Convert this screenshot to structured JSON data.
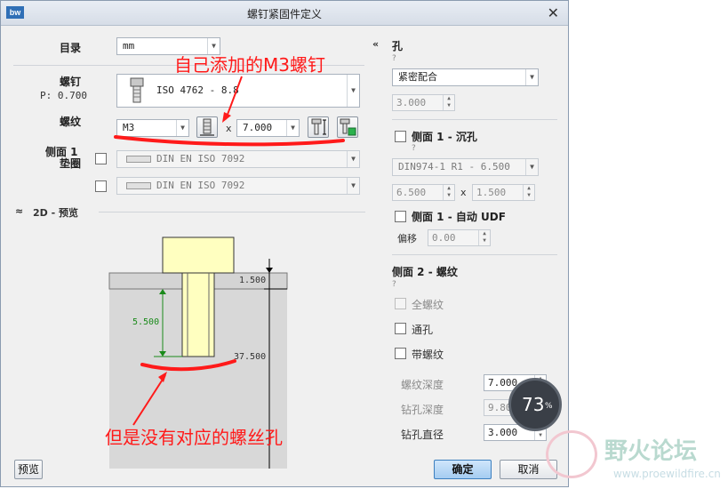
{
  "window": {
    "title": "螺钉紧固件定义",
    "logo": "bw"
  },
  "left": {
    "catalog_label": "目录",
    "catalog_value": "mm",
    "screw_label": "螺钉",
    "pitch_label": "P: 0.700",
    "screw_value": "ISO 4762 - 8.8",
    "thread_label": "螺纹",
    "thread_value": "M3",
    "times": "x",
    "length_value": "7.000",
    "side1_label_a": "侧面 1",
    "side1_label_b": "垫圈",
    "washer1_value": "DIN EN ISO 7092",
    "washer2_value": "DIN EN ISO 7092",
    "preview_section": "2D - 预览"
  },
  "preview": {
    "dim_top": "1.500",
    "dim_mid": "5.500",
    "dim_bottom": "37.500"
  },
  "right": {
    "hole_label": "孔",
    "hole_q": "?",
    "fit_value": "紧密配合",
    "fit_num": "3.000",
    "side1_counter_label": "侧面 1 - 沉孔",
    "side1_q": "?",
    "counter_value": "DIN974-1 R1 - 6.500",
    "counter_a": "6.500",
    "counter_x": "x",
    "counter_b": "1.500",
    "auto_udf_label": "侧面 1 - 自动 UDF",
    "offset_label": "偏移",
    "offset_value": "0.00",
    "side2_label": "侧面 2 - 螺纹",
    "side2_q": "?",
    "full_thread": "全螺纹",
    "through_hole": "通孔",
    "with_thread": "带螺纹",
    "thread_depth_label": "螺纹深度",
    "thread_depth_value": "7.000",
    "drill_depth_label": "钻孔深度",
    "drill_depth_value": "9.800",
    "drill_dia_label": "钻孔直径",
    "drill_dia_value": "3.000"
  },
  "buttons": {
    "preview": "预览",
    "ok": "确定",
    "cancel": "取消"
  },
  "annotations": {
    "top_note": "自己添加的M3螺钉",
    "bottom_note": "但是没有对应的螺丝孔"
  },
  "badge": {
    "value": "73",
    "unit": "%"
  },
  "watermark": {
    "name": "野火论坛",
    "url": "www.proewildfire.cn"
  }
}
